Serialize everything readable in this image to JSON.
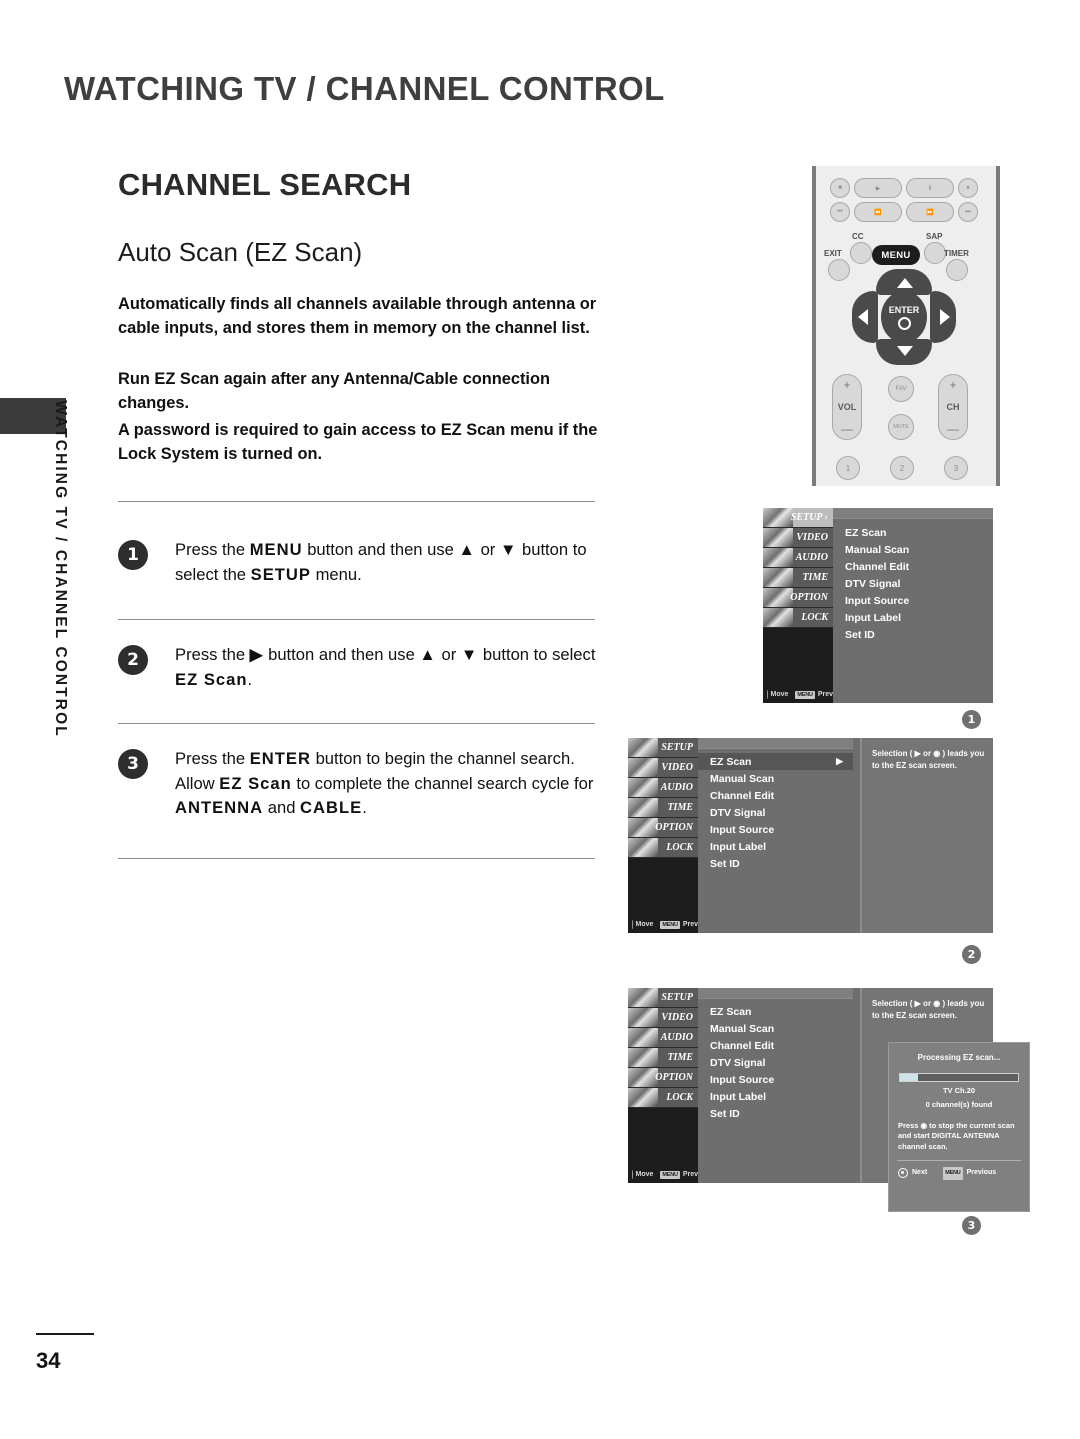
{
  "header": {
    "title": "WATCHING TV / CHANNEL CONTROL",
    "side_tab_text": "WATCHING TV / CHANNEL CONTROL"
  },
  "content": {
    "section_title": "CHANNEL SEARCH",
    "sub_title": "Auto Scan (EZ Scan)",
    "paragraph_1": "Automatically finds all channels available through antenna or cable inputs, and stores them in memory on the channel list.",
    "paragraph_2": "Run EZ Scan again after any Antenna/Cable connection changes.",
    "paragraph_3": "A password is required to gain access to EZ Scan menu if the Lock System is turned on."
  },
  "steps": [
    {
      "number": "1",
      "text_parts": [
        "Press the ",
        "MENU",
        " button and then use ",
        "▲",
        " or ",
        "▼",
        " button to select the ",
        "SETUP",
        " menu."
      ]
    },
    {
      "number": "2",
      "text_parts": [
        "Press the ",
        "▶",
        " button and then use ",
        "▲",
        " or ",
        "▼",
        " button to select ",
        "EZ Scan",
        "."
      ]
    },
    {
      "number": "3",
      "text_parts": [
        "Press the ",
        "ENTER",
        " button to begin the channel search. Allow ",
        "EZ Scan",
        " to complete the channel search cycle for ",
        "ANTENNA",
        " and ",
        "CABLE",
        "."
      ]
    }
  ],
  "remote": {
    "menu_key": "MENU",
    "enter_key": "ENTER",
    "labels": {
      "cc": "CC",
      "sap": "SAP",
      "exit": "EXIT",
      "timer": "TIMER",
      "vol": "VOL",
      "ch": "CH",
      "fav": "FAV",
      "mute": "MUTE",
      "plus": "+",
      "minus": "—"
    },
    "transport_row1": [
      "■",
      "▶",
      "Ⅱ",
      "●"
    ],
    "transport_row2": [
      "⏮",
      "⏪",
      "⏩",
      "⏭"
    ],
    "number_keys": [
      "1",
      "2",
      "3"
    ]
  },
  "tv_menu": {
    "tabs": [
      "SETUP",
      "VIDEO",
      "AUDIO",
      "TIME",
      "OPTION",
      "LOCK"
    ],
    "selected_tab": "SETUP",
    "tab_arrow": "›",
    "items": [
      "EZ Scan",
      "Manual Scan",
      "Channel Edit",
      "DTV Signal",
      "Input Source",
      "Input Label",
      "Set ID"
    ],
    "selected_item": "EZ Scan",
    "item_arrow": "▶",
    "footer_move": "Move",
    "footer_prev": "Prev",
    "footer_prev_key": "MENU",
    "info_text": "Selection ( ▶ or ◉ ) leads you to the EZ scan screen."
  },
  "callouts": [
    "1",
    "2",
    "3"
  ],
  "dialog": {
    "title": "Processing EZ scan...",
    "progress_percent": 15,
    "channel_label": "TV Ch.20",
    "found_label": "0 channel(s) found",
    "body": "Press ◉ to stop the current scan and start DIGITAL ANTENNA channel scan.",
    "next_label": "Next",
    "previous_label": "Previous",
    "previous_key": "MENU"
  },
  "footer": {
    "page_number": "34"
  },
  "colors": {
    "header_gray": "#3f3f3f",
    "menu_bg": "#6e6e6e",
    "tab_dark": "#1d1d1d",
    "badge_dark": "#2e2e2e",
    "callout_gray": "#707070",
    "progress_fill": "#cfe3ea"
  }
}
